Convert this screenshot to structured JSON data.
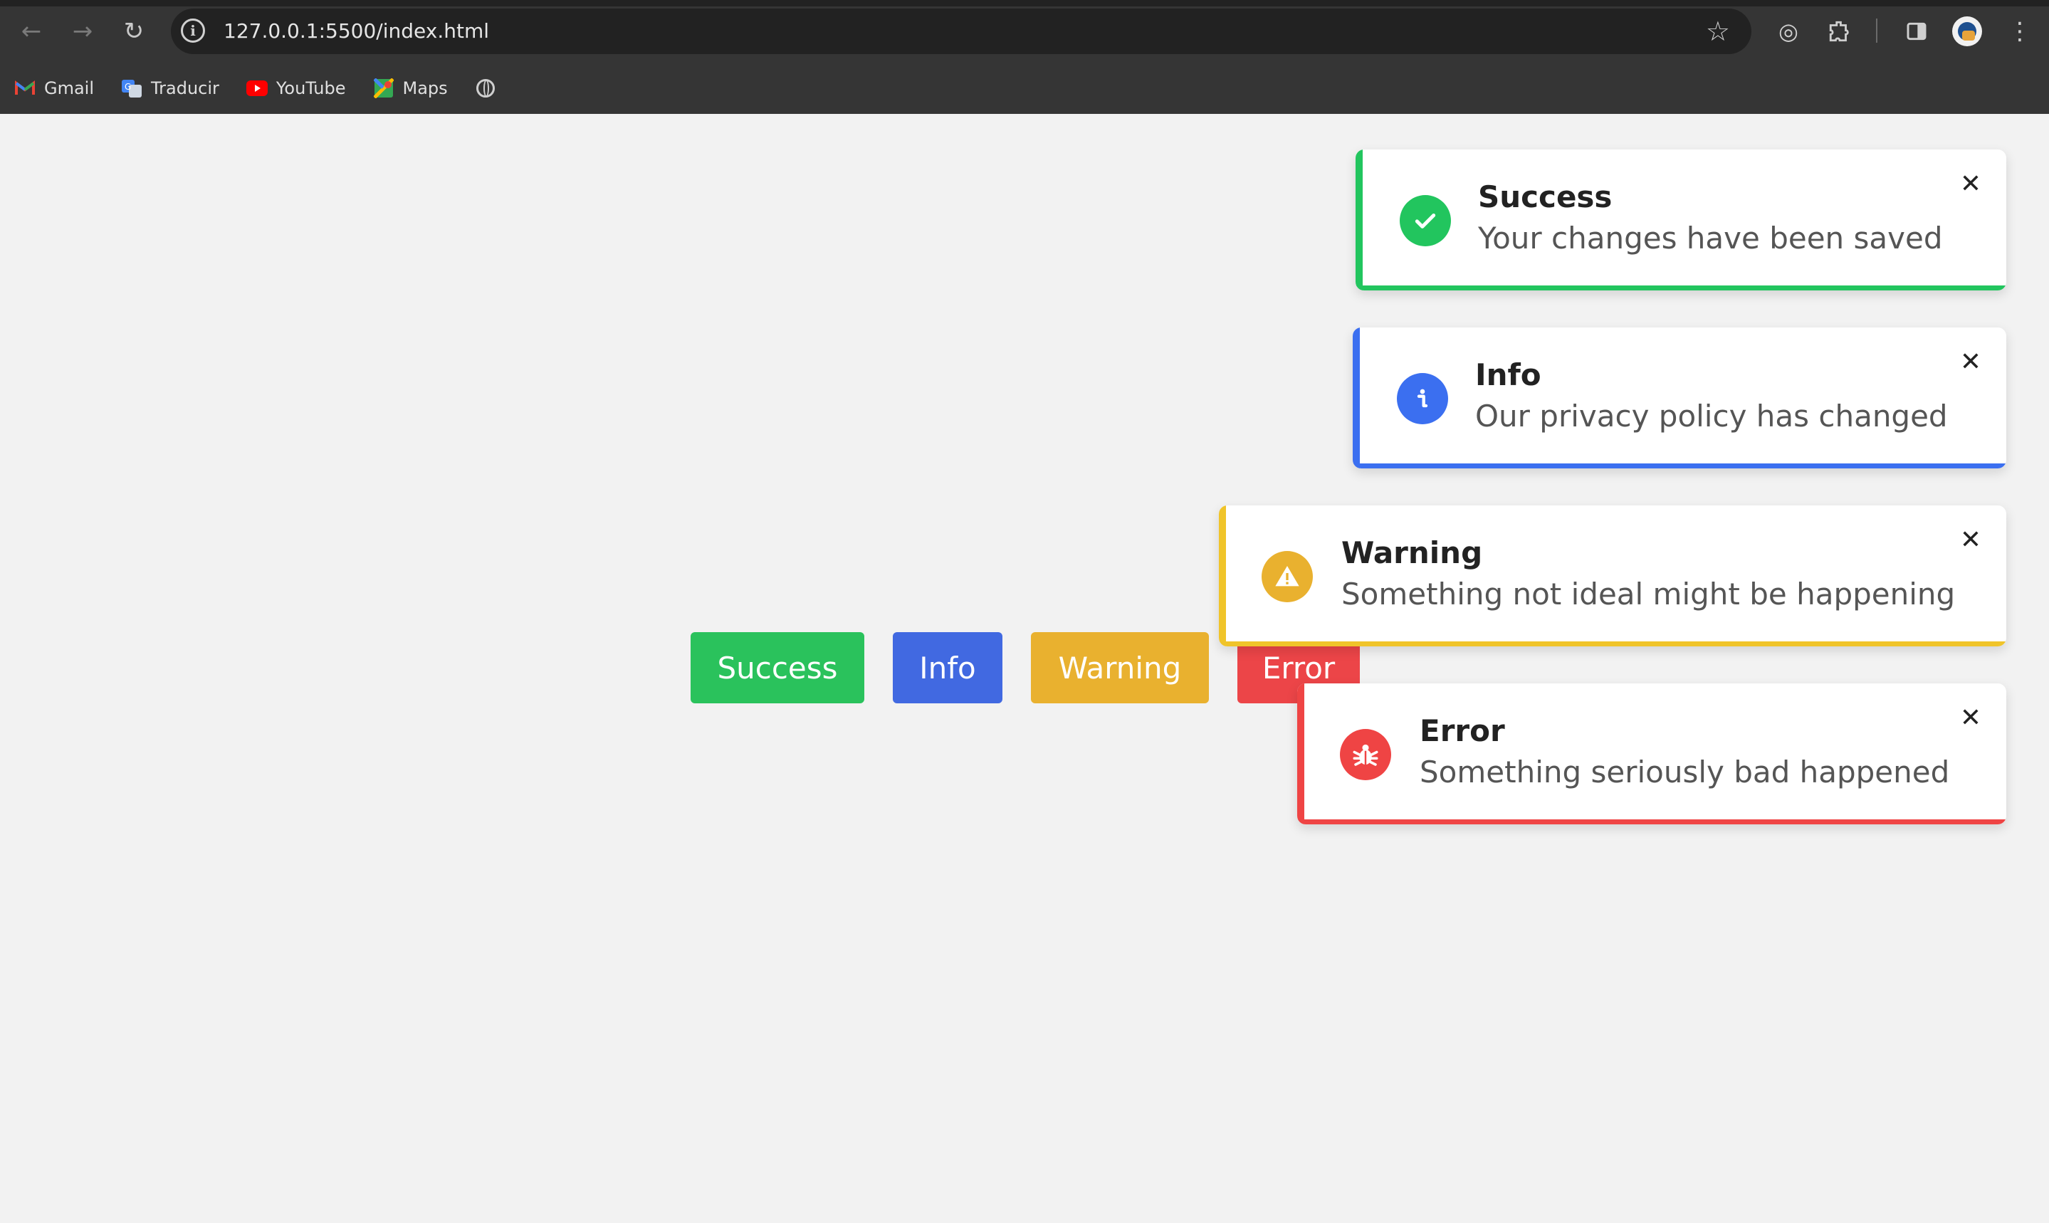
{
  "browser": {
    "url": "127.0.0.1:5500/index.html",
    "bookmarks": [
      {
        "label": "Gmail",
        "icon": "gmail-icon"
      },
      {
        "label": "Traducir",
        "icon": "translate-icon"
      },
      {
        "label": "YouTube",
        "icon": "youtube-icon"
      },
      {
        "label": "Maps",
        "icon": "maps-icon"
      }
    ]
  },
  "buttons": {
    "success": "Success",
    "info": "Info",
    "warning": "Warning",
    "error": "Error"
  },
  "toasts": [
    {
      "type": "success",
      "title": "Success",
      "message": "Your changes have been saved",
      "color": "#22c55e",
      "icon": "check-icon"
    },
    {
      "type": "info",
      "title": "Info",
      "message": "Our privacy policy has changed",
      "color": "#3b6ff0",
      "icon": "info-icon"
    },
    {
      "type": "warning",
      "title": "Warning",
      "message": "Something not ideal might be happening",
      "color": "#f0c42a",
      "icon": "warning-icon"
    },
    {
      "type": "error",
      "title": "Error",
      "message": "Something seriously bad happened",
      "color": "#ef4444",
      "icon": "bug-icon"
    }
  ],
  "colors": {
    "success": "#2ac25c",
    "info": "#4169e1",
    "warning": "#e9b12f",
    "error": "#ec4548"
  }
}
